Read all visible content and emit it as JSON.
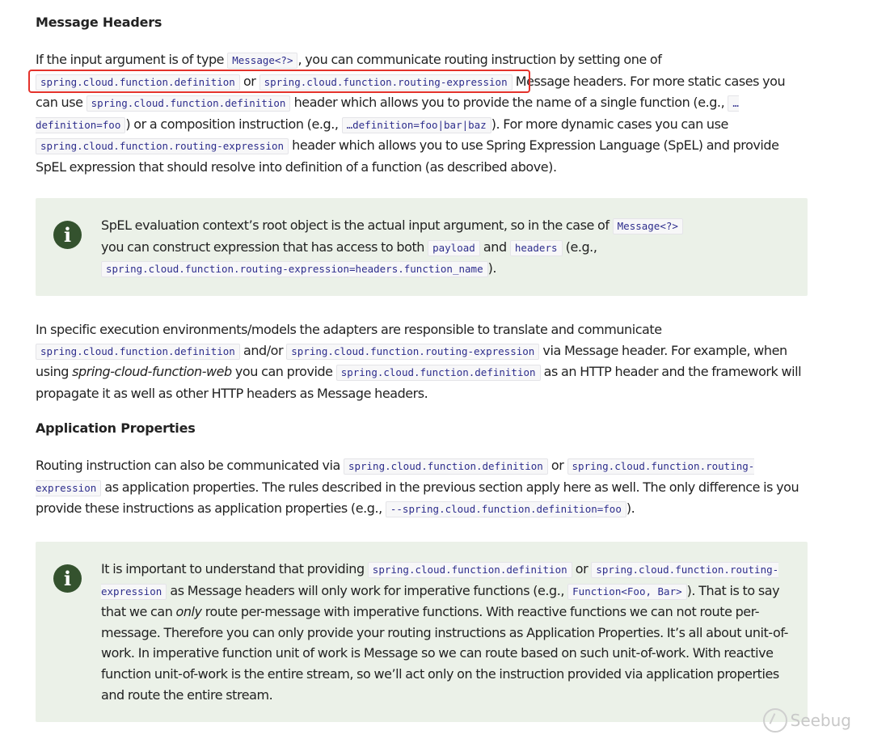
{
  "section1": {
    "heading": "Message Headers",
    "p1": {
      "t1": "If the input argument is of type ",
      "c1": "Message<?>",
      "t2": ", you can communicate routing instruction by setting one of ",
      "c2": "spring.cloud.function.definition",
      "t3": " or ",
      "c3": "spring.cloud.function.routing-expression",
      "t4": " Message headers. For more static cases you can use ",
      "c4": "spring.cloud.function.definition",
      "t5": " header which allows you to provide the name of a single function (e.g., ",
      "c5": "…definition=foo",
      "t6": ") or a composition instruction (e.g., ",
      "c6": "…definition=foo|bar|baz",
      "t7": "). For more dynamic cases you can use ",
      "c7": "spring.cloud.function.routing-expression",
      "t8": " header which allows you to use Spring Expression Language (SpEL) and provide SpEL expression that should resolve into definition of a function (as described above)."
    },
    "note": {
      "t1": "SpEL evaluation context’s root object is the actual input argument, so in the case of ",
      "c1": "Message<?>",
      "t2": " you can construct expression that has access to both ",
      "c2": "payload",
      "t3": " and ",
      "c3": "headers",
      "t4": " (e.g., ",
      "c4": "spring.cloud.function.routing-expression=headers.function_name",
      "t5": ")."
    },
    "p2": {
      "t1": "In specific execution environments/models the adapters are responsible to translate and communicate ",
      "c1": "spring.cloud.function.definition",
      "t2": " and/or ",
      "c2": "spring.cloud.function.routing-expression",
      "t3": " via Message header. For example, when using ",
      "em1": "spring-cloud-function-web",
      "t4": " you can provide ",
      "c3": "spring.cloud.function.definition",
      "t5": " as an HTTP header and the framework will propagate it as well as other HTTP headers as Message headers."
    }
  },
  "section2": {
    "heading": "Application Properties",
    "p1": {
      "t1": "Routing instruction can also be communicated via ",
      "c1": "spring.cloud.function.definition",
      "t2": " or ",
      "c2": "spring.cloud.function.routing-expression",
      "t3": " as application properties. The rules described in the previous section apply here as well. The only difference is you provide these instructions as application properties (e.g., ",
      "c3": "--spring.cloud.function.definition=foo",
      "t4": ")."
    },
    "note": {
      "t1": "It is important to understand that providing ",
      "c1": "spring.cloud.function.definition",
      "t2": " or ",
      "c2": "spring.cloud.function.routing-expression",
      "t3": " as Message headers will only work for imperative functions (e.g., ",
      "c3": "Function<Foo, Bar>",
      "t4": "). That is to say that we can ",
      "em1": "only",
      "t5": " route per-message with imperative functions. With reactive functions we can not route per-message. Therefore you can only provide your routing instructions as Application Properties. It’s all about unit-of-work. In imperative function unit of work is Message so we can route based on such unit-of-work. With reactive function unit-of-work is the entire stream, so we’ll act only on the instruction provided via application properties and route the entire stream."
    }
  },
  "icons": {
    "note_icon": "info-circle-icon",
    "note_glyph": "i"
  },
  "watermark": {
    "text": "Seebug"
  },
  "colors": {
    "note_background": "#ebf1e8",
    "note_icon": "#34522e",
    "highlight_border": "#e4322b",
    "code_text": "#2d2d8c"
  }
}
